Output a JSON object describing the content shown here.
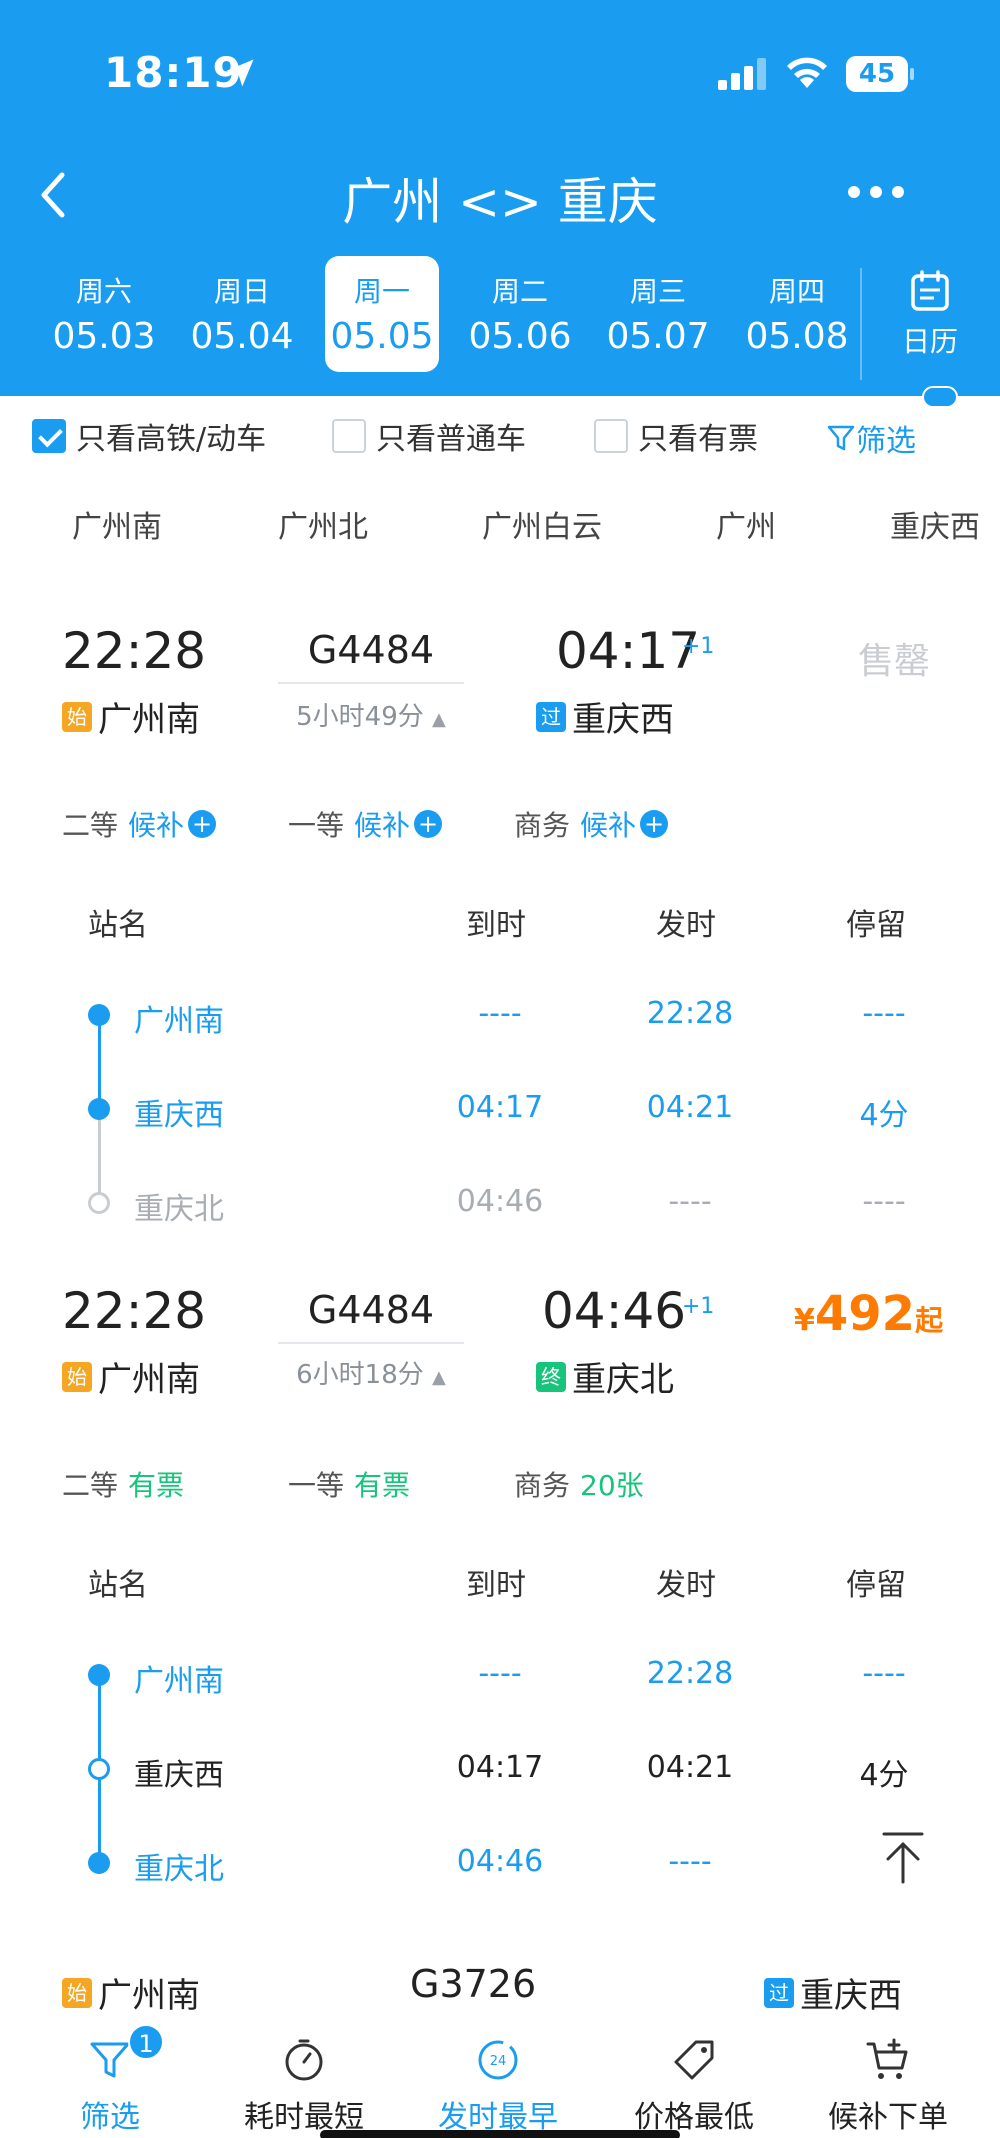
{
  "status_bar": {
    "time": "18:19",
    "battery": "45"
  },
  "nav": {
    "title": "广州 <> 重庆"
  },
  "dates": [
    {
      "dow": "周六",
      "date": "05.03"
    },
    {
      "dow": "周日",
      "date": "05.04"
    },
    {
      "dow": "周一",
      "date": "05.05"
    },
    {
      "dow": "周二",
      "date": "05.06"
    },
    {
      "dow": "周三",
      "date": "05.07"
    },
    {
      "dow": "周四",
      "date": "05.08"
    }
  ],
  "active_date_index": 2,
  "calendar_label": "日历",
  "filters": {
    "high_speed": "只看高铁/动车",
    "normal": "只看普通车",
    "available": "只看有票",
    "screen": "筛选"
  },
  "stations": [
    "广州南",
    "广州北",
    "广州白云",
    "广州",
    "重庆西"
  ],
  "trains": [
    {
      "dep_time": "22:28",
      "number": "G4484",
      "duration": "5小时49分",
      "arr_time": "04:17",
      "day_offset": "+1",
      "from_tag": "始",
      "from": "广州南",
      "to_tag": "过",
      "to": "重庆西",
      "status": "售罄",
      "seats": [
        {
          "class": "二等",
          "avail": "候补"
        },
        {
          "class": "一等",
          "avail": "候补"
        },
        {
          "class": "商务",
          "avail": "候补"
        }
      ],
      "stops_header": {
        "name": "站名",
        "arrive": "到时",
        "depart": "发时",
        "stay": "停留"
      },
      "stops": [
        {
          "name": "广州南",
          "arrive": "----",
          "depart": "22:28",
          "stay": "----"
        },
        {
          "name": "重庆西",
          "arrive": "04:17",
          "depart": "04:21",
          "stay": "4分"
        },
        {
          "name": "重庆北",
          "arrive": "04:46",
          "depart": "----",
          "stay": "----"
        }
      ]
    },
    {
      "dep_time": "22:28",
      "number": "G4484",
      "duration": "6小时18分",
      "arr_time": "04:46",
      "day_offset": "+1",
      "from_tag": "始",
      "from": "广州南",
      "to_tag": "终",
      "to": "重庆北",
      "price_symbol": "¥",
      "price": "492",
      "price_suffix": "起",
      "seats": [
        {
          "class": "二等",
          "avail": "有票"
        },
        {
          "class": "一等",
          "avail": "有票"
        },
        {
          "class": "商务",
          "avail": "20张"
        }
      ],
      "stops_header": {
        "name": "站名",
        "arrive": "到时",
        "depart": "发时",
        "stay": "停留"
      },
      "stops": [
        {
          "name": "广州南",
          "arrive": "----",
          "depart": "22:28",
          "stay": "----"
        },
        {
          "name": "重庆西",
          "arrive": "04:17",
          "depart": "04:21",
          "stay": "4分"
        },
        {
          "name": "重庆北",
          "arrive": "04:46",
          "depart": "----",
          "stay": ""
        }
      ]
    },
    {
      "number": "G3726",
      "from_tag": "始",
      "from": "广州南",
      "to_tag": "过",
      "to": "重庆西"
    }
  ],
  "bottom_bar": [
    {
      "label": "筛选",
      "badge": "1",
      "icon": "funnel-icon"
    },
    {
      "label": "耗时最短",
      "icon": "timer-icon"
    },
    {
      "label": "发时最早",
      "icon": "clock-24-icon",
      "icon_text": "24"
    },
    {
      "label": "价格最低",
      "icon": "price-tag-icon"
    },
    {
      "label": "候补下单",
      "icon": "cart-plus-icon"
    }
  ]
}
